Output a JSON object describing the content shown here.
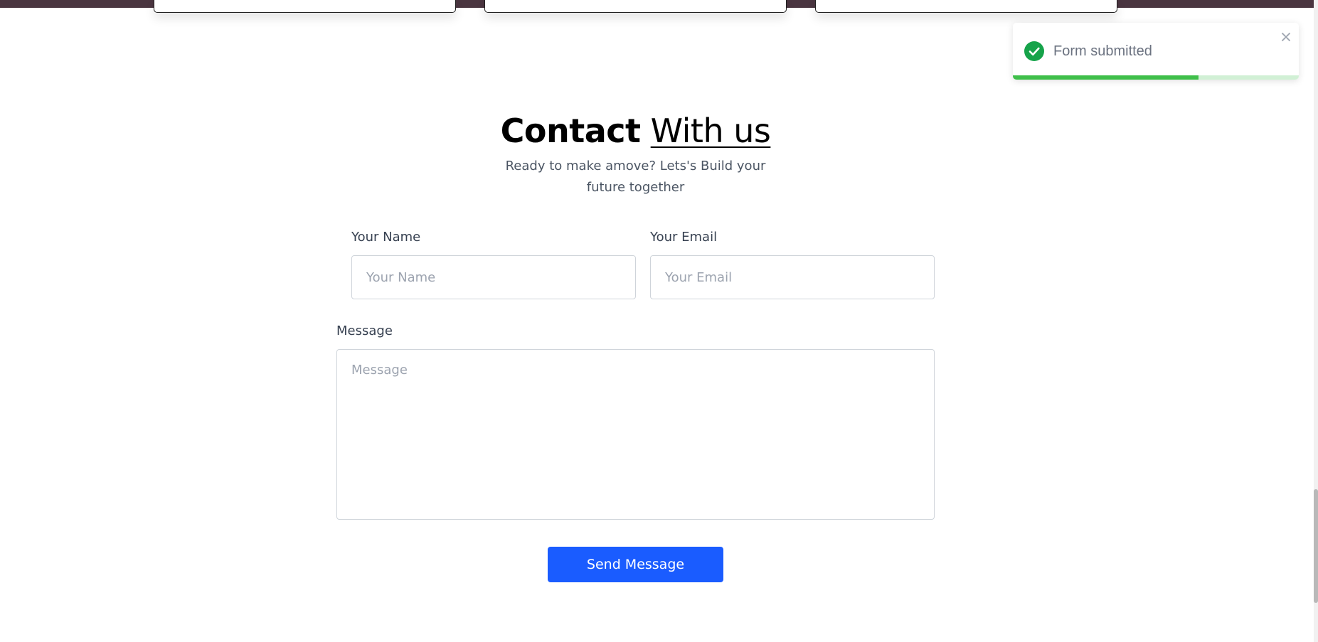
{
  "heading": {
    "bold_text": "Contact",
    "light_text": "With us"
  },
  "subtitle": "Ready to make amove? Lets's Build your future together",
  "form": {
    "name_label": "Your Name",
    "name_placeholder": "Your Name",
    "email_label": "Your Email",
    "email_placeholder": "Your Email",
    "message_label": "Message",
    "message_placeholder": "Message",
    "submit_label": "Send Message"
  },
  "toast": {
    "message": "Form submitted",
    "icon": "check-circle-icon",
    "progress_fraction": 0.65,
    "accent_color": "#3fbf4a"
  },
  "colors": {
    "primary_button": "#1a5cff",
    "top_strip": "#4a3540"
  }
}
